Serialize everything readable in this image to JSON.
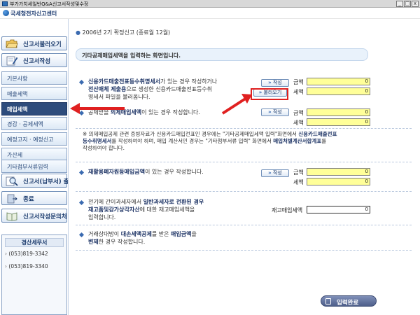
{
  "window": {
    "title": "부가가치세일반Q&A신고서작성및수정",
    "controls": [
      "_",
      "□",
      "x"
    ]
  },
  "header": {
    "logo_text": "국세청전자신고센터"
  },
  "breadcrumb": "2006년 2기 확정신고 (종료월 12월)",
  "sidebar": {
    "buttons": {
      "load": "신고서불러오기",
      "write": "신고서작성",
      "print": "신고서(납부서) 출력",
      "exit": "종료",
      "inquiry": "신고서작성문의처"
    },
    "menu": [
      {
        "label": "기본사항"
      },
      {
        "label": "매출세액"
      },
      {
        "label": "매입세액",
        "active": true
      },
      {
        "label": "경감 · 공제세액"
      },
      {
        "label": "예정고지 · 예정신고"
      },
      {
        "label": "가산세"
      },
      {
        "label": "기타첨부서류입력"
      }
    ],
    "info": {
      "title": "경산세무서",
      "phones": [
        "(053)819-3342",
        "(053)819-3340"
      ]
    }
  },
  "intro": "기타공제매입세액을 입력하는 화면입니다.",
  "labels": {
    "write_btn": "작성",
    "load_btn": "불러오기",
    "amount": "금액",
    "tax": "세액",
    "inventory_tax": "재고매입세액"
  },
  "sections": [
    {
      "line1_a": "신용카드매출전표등수취명세서",
      "line1_b": "가 있는 경우 작성하거나",
      "line2_a": "전산매체 제출용",
      "line2_b": "으로 생성한 신용카드매출전표등수취",
      "line3": "명세서 파일을 불러옵니다.",
      "amount": "0",
      "tax": "0"
    },
    {
      "line1_a": "공제받을 ",
      "line1_b": "의제매입세액",
      "line1_c": "이 있는 경우 작성합니다.",
      "amount": "0",
      "tax": "0"
    },
    {
      "line1_a": "재활용폐자원등매입금액",
      "line1_b": "이 있는 경우 작성합니다.",
      "amount": "0",
      "tax": "0"
    },
    {
      "line1_a": "전기에 간이과세자에서 ",
      "line1_b": "일반과세자로 전환된 경우",
      "line2_a": "재고품및감가상각자산",
      "line2_b": "에 대한 재고매입세액을",
      "line3": "입력합니다.",
      "value": "0"
    },
    {
      "line1_a": "거래상대방이 ",
      "line1_b": "대손세액공제",
      "line1_c": "를 받은 ",
      "line1_d": "매입금액",
      "line1_e": "을",
      "line2_a": "변제",
      "line2_b": "한 경우 작성합니다."
    }
  ],
  "note": {
    "p1": "※ 의제매입공제 관련 증빙자료가 신용카드매입전표인 경우에는 \"기타공제매입세액 입력\"화면에서 ",
    "p1b": "신용카드매출전표",
    "p2": "등수취명세서",
    "p2b": "를 작성하여야 하며, 매입 계산서인 경우는 \"기타첨부서류 입력\" 화면에서 ",
    "p2c": "매입처별계산서합계표",
    "p2d": "를",
    "p3": "작성하여야 합니다."
  },
  "complete_button": "입력완료",
  "colors": {
    "accent": "#2e4c7c",
    "input_bg": "#ffff99",
    "annotation": "#e02020"
  }
}
